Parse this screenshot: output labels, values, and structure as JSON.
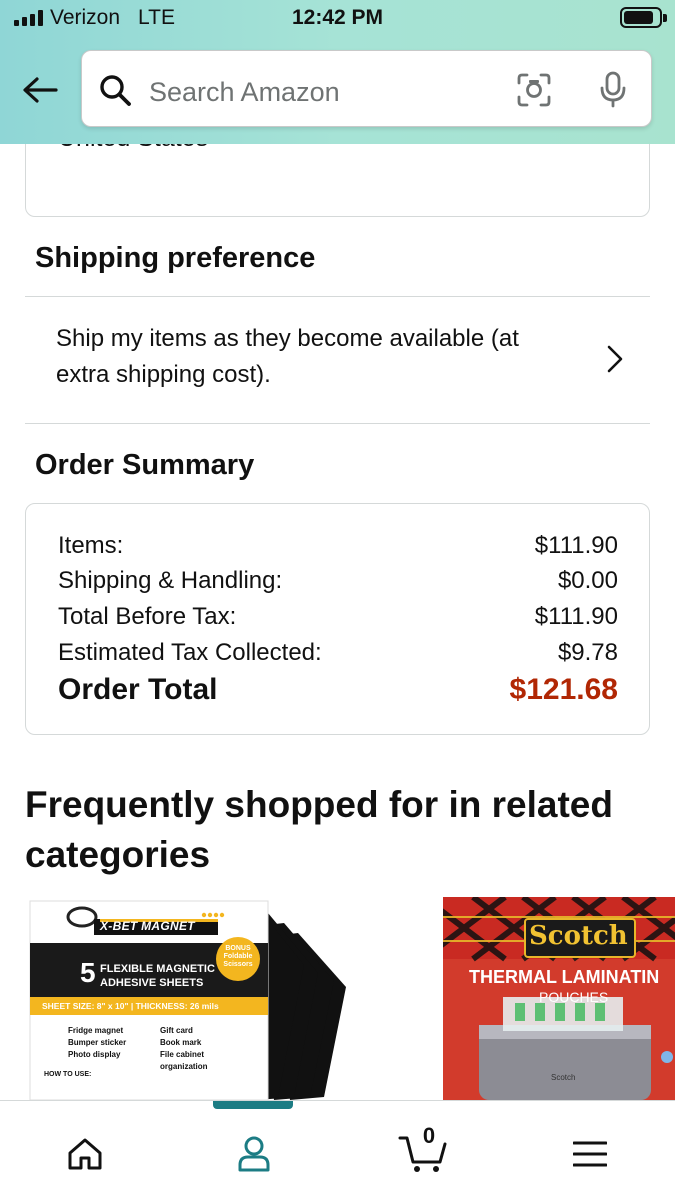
{
  "status_bar": {
    "carrier": "Verizon",
    "network": "LTE",
    "time": "12:42 PM"
  },
  "search": {
    "placeholder": "Search Amazon"
  },
  "address": {
    "clipped_text": "United States"
  },
  "shipping_preference": {
    "title": "Shipping preference",
    "option_text": "Ship my items as they become available (at extra shipping cost)."
  },
  "order_summary": {
    "title": "Order Summary",
    "rows": [
      {
        "label": "Items:",
        "amount": "$111.90"
      },
      {
        "label": "Shipping & Handling:",
        "amount": "$0.00"
      },
      {
        "label": "Total Before Tax:",
        "amount": "$111.90"
      },
      {
        "label": "Estimated Tax Collected:",
        "amount": "$9.78"
      }
    ],
    "total": {
      "label": "Order Total",
      "amount": "$121.68"
    }
  },
  "frequently_shopped": {
    "title": "Frequently shopped for in related categories",
    "products": [
      {
        "brand": "X-BET MAGNET",
        "count": "5",
        "headline_1": "FLEXIBLE MAGNETIC",
        "headline_2": "ADHESIVE SHEETS",
        "bonus": "BONUS Foldable Scissors",
        "spec": "SHEET SIZE: 8\" x 10\" | THICKNESS: 26 mils",
        "uses_left": [
          "Fridge magnet",
          "Bumper sticker",
          "Photo display"
        ],
        "uses_right": [
          "Gift card",
          "Book mark",
          "File cabinet organization"
        ],
        "how_to": "HOW TO USE:"
      },
      {
        "brand": "Scotch",
        "headline": "THERMAL LAMINATIN",
        "subheadline": "POUCHES",
        "device_label": "Scotch"
      }
    ]
  },
  "bottom_nav": {
    "cart_count": "0",
    "active_tab": "account"
  },
  "colors": {
    "header_gradient_start": "#8fd6d6",
    "header_gradient_end": "#a8e3cf",
    "order_total": "#b12704",
    "active_tab": "#1c7c84",
    "border": "#d5d9d9"
  }
}
